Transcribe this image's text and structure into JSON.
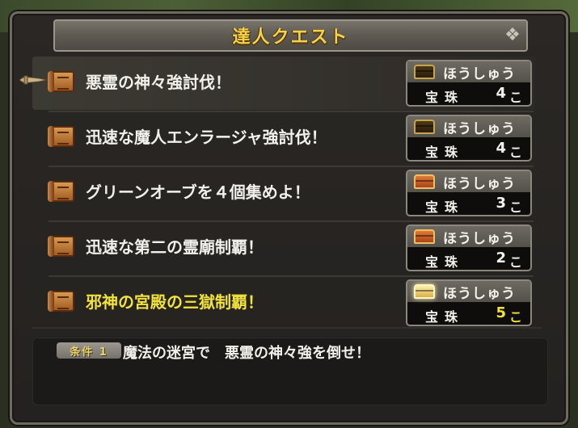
{
  "title": "達人クエスト",
  "reward_label": "ほうしゅう",
  "quests": [
    {
      "name": "悪霊の神々強討伐！",
      "chest": "dark-chest-icon",
      "item": "宝珠",
      "count": "4",
      "unit": "こ",
      "highlight": false
    },
    {
      "name": "迅速な魔人エンラージャ強討伐！",
      "chest": "dark-chest-icon",
      "item": "宝珠",
      "count": "4",
      "unit": "こ",
      "highlight": false
    },
    {
      "name": "グリーンオーブを４個集めよ！",
      "chest": "red-chest-icon",
      "item": "宝珠",
      "count": "3",
      "unit": "こ",
      "highlight": false
    },
    {
      "name": "迅速な第二の霊廟制覇！",
      "chest": "red-chest-icon",
      "item": "宝珠",
      "count": "2",
      "unit": "こ",
      "highlight": false
    },
    {
      "name": "邪神の宮殿の三獄制覇！",
      "chest": "gold-chest-icon",
      "item": "宝珠",
      "count": "5",
      "unit": "こ",
      "highlight": true
    }
  ],
  "condition": {
    "badge": "条件 1",
    "text": "魔法の迷宮で　悪霊の神々強を倒せ！"
  },
  "colors": {
    "title": "#f4d24a",
    "highlight": "#f2e23c",
    "text": "#f2f0ea"
  }
}
